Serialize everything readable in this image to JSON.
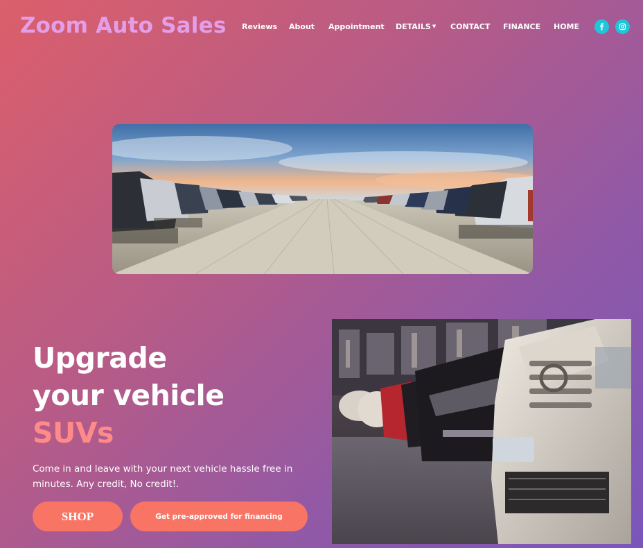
{
  "brand": {
    "name": "Zoom Auto Sales"
  },
  "nav": {
    "items": [
      {
        "label": "Reviews"
      },
      {
        "label": "About"
      },
      {
        "label": "Appointment"
      },
      {
        "label": "DETAILS",
        "icon": "caret-down-icon"
      },
      {
        "label": "CONTACT"
      },
      {
        "label": "FINANCE"
      },
      {
        "label": "HOME"
      }
    ],
    "social": [
      {
        "icon": "facebook-icon",
        "color": "#1ec6d8"
      },
      {
        "icon": "instagram-icon",
        "color": "#1ec6d8"
      }
    ]
  },
  "hero": {
    "headline_line1": "Upgrade",
    "headline_line2": "your vehicle",
    "headline_accent": "SUVs",
    "lead": "Come in and leave with your next vehicle hassle free in minutes. Any credit, No credit!.",
    "shop_button": "SHOP",
    "finance_button": "Get pre-approved for financing"
  },
  "colors": {
    "brand": "#e39ee8",
    "accent_text": "#ff8a8a",
    "button": "#f87565",
    "social": "#1ec6d8",
    "gradient_start": "#dc5f6b",
    "gradient_end": "#7a56bb"
  }
}
